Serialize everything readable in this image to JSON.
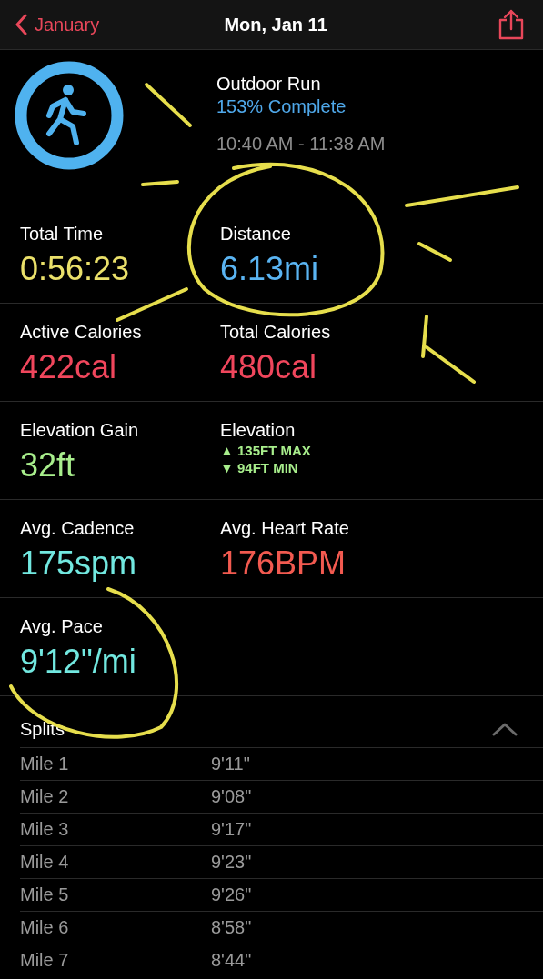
{
  "header": {
    "back_label": "January",
    "title": "Mon, Jan 11"
  },
  "workout": {
    "name": "Outdoor Run",
    "completion": "153% Complete",
    "time_range": "10:40 AM - 11:38 AM"
  },
  "stats": [
    {
      "kind": "value",
      "label": "Total Time",
      "value": "0:56:23",
      "color": "#eae06a"
    },
    {
      "kind": "value",
      "label": "Distance",
      "value": "6.13mi",
      "color": "#5ab4f2"
    },
    {
      "kind": "value",
      "label": "Active Calories",
      "value": "422cal",
      "color": "#f0465c"
    },
    {
      "kind": "value",
      "label": "Total Calories",
      "value": "480cal",
      "color": "#f0465c"
    },
    {
      "kind": "value",
      "label": "Elevation Gain",
      "value": "32ft",
      "color": "#a8ee8c"
    },
    {
      "kind": "range",
      "label": "Elevation",
      "max": "▲ 135FT MAX",
      "min": "▼ 94FT MIN",
      "color": "#a8ee8c"
    },
    {
      "kind": "value",
      "label": "Avg. Cadence",
      "value": "175spm",
      "color": "#72e8e0"
    },
    {
      "kind": "value",
      "label": "Avg. Heart Rate",
      "value": "176BPM",
      "color": "#f25a50"
    },
    {
      "kind": "value",
      "label": "Avg. Pace",
      "value": "9'12\"/mi",
      "color": "#72e8e0"
    }
  ],
  "splits": {
    "title": "Splits",
    "expanded": true,
    "rows": [
      {
        "label": "Mile 1",
        "time": "9'11\""
      },
      {
        "label": "Mile 2",
        "time": "9'08\""
      },
      {
        "label": "Mile 3",
        "time": "9'17\""
      },
      {
        "label": "Mile 4",
        "time": "9'23\""
      },
      {
        "label": "Mile 5",
        "time": "9'26\""
      },
      {
        "label": "Mile 6",
        "time": "8'58\""
      },
      {
        "label": "Mile 7",
        "time": "8'44\""
      }
    ]
  }
}
